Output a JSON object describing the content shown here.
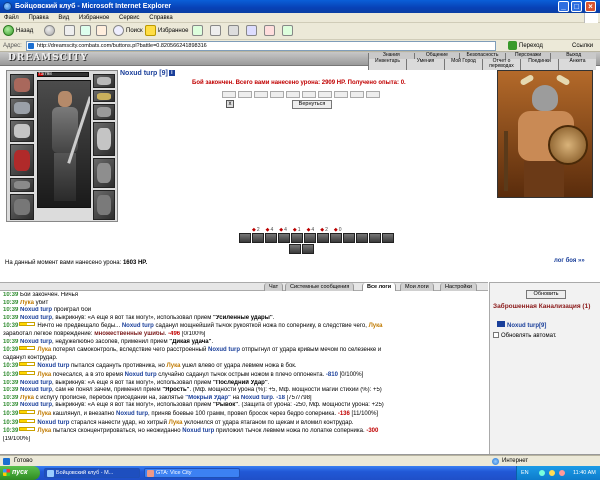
{
  "window": {
    "title": "Бойцовский клуб - Microsoft Internet Explorer",
    "min": "_",
    "max": "□",
    "close": "×"
  },
  "menu": [
    "Файл",
    "Правка",
    "Вид",
    "Избранное",
    "Сервис",
    "Справка"
  ],
  "toolbar": {
    "back": "Назад",
    "search": "Поиск",
    "favorites": "Избранное"
  },
  "address": {
    "label": "Адрес:",
    "url": "http://dreamscity.combats.com/buttons.pl?battle=0.820566241898316",
    "go": "Переход",
    "links": "Ссылки"
  },
  "site": {
    "logo": "DREAMSCITY",
    "nav_top": [
      "Знания",
      "Общение",
      "Безопасность",
      "Персонажи",
      "Выход"
    ],
    "nav_bottom": [
      "Инвентарь",
      "Умения",
      "Мой Город",
      "Отчет о переводах",
      "Поединки",
      "Анкета"
    ]
  },
  "player": {
    "name": "Noxud turp [9]",
    "hp": "73/798",
    "hp_fraction": 0.09
  },
  "battle": {
    "summary": "Бой закончен. Всего вами нанесено урона: 2909 HP. Получено опыта: 0.",
    "close": "x",
    "return_button": "Вернуться",
    "stats": [
      "2",
      "4",
      "4",
      "1",
      "4",
      "2",
      "0"
    ],
    "damage_label": "На данный момент вами нанесено урона:",
    "damage_value": "1603 HP.",
    "log_link": "лог боя »»"
  },
  "chat": {
    "tabs": [
      "Чат",
      "Системные сообщения",
      "Все логи",
      "Мои логи",
      "Настройки"
    ],
    "lines": [
      [
        {
          "c": "t",
          "v": "10:39"
        },
        {
          "c": "",
          "v": " Бой закончен. Ничья"
        }
      ],
      [
        {
          "c": "t",
          "v": "10:39"
        },
        {
          "c": "",
          "v": " "
        },
        {
          "c": "e",
          "v": "Лука"
        },
        {
          "c": "",
          "v": " убит"
        }
      ],
      [
        {
          "c": "t",
          "v": "10:39"
        },
        {
          "c": "",
          "v": " "
        },
        {
          "c": "p",
          "v": "Noxud turp"
        },
        {
          "c": "",
          "v": " проиграл бой"
        }
      ],
      [
        {
          "c": "t",
          "v": "10:39"
        },
        {
          "c": "",
          "v": " "
        },
        {
          "c": "p",
          "v": "Noxud turp"
        },
        {
          "c": "",
          "v": ", выкрикнув: «А ещё я вот так могу!», использовал прием "
        },
        {
          "c": "q",
          "v": "\"Усиленные удары\""
        },
        {
          "c": "",
          "v": "."
        }
      ],
      [
        {
          "c": "t",
          "v": "10:39"
        },
        {
          "c": "m",
          "v": ""
        },
        {
          "c": "",
          "v": "Ничто не предвещало беды... "
        },
        {
          "c": "p",
          "v": "Noxud turp"
        },
        {
          "c": "",
          "v": " саданул мощнейший тычок рукояткой ножа по сопернику, в следствие чего, "
        },
        {
          "c": "e",
          "v": "Лука"
        }
      ],
      [
        {
          "c": "",
          "v": "заработал легкое повреждение: "
        },
        {
          "c": "w",
          "v": "множественные ушибы"
        },
        {
          "c": "",
          "v": ". "
        },
        {
          "c": "n",
          "v": "-496"
        },
        {
          "c": "",
          "v": " [0/100%]"
        }
      ],
      [
        {
          "c": "t",
          "v": "10:39"
        },
        {
          "c": "",
          "v": " "
        },
        {
          "c": "p",
          "v": "Noxud turp"
        },
        {
          "c": "",
          "v": ", недужелюбно засопев, применил прием "
        },
        {
          "c": "q",
          "v": "\"Дикая удача\""
        },
        {
          "c": "",
          "v": "."
        }
      ],
      [
        {
          "c": "t",
          "v": "10:39"
        },
        {
          "c": "m",
          "v": ""
        },
        {
          "c": "e",
          "v": "Лука"
        },
        {
          "c": "",
          "v": " потерял самоконтроль, вследствие чего расстроенный "
        },
        {
          "c": "p",
          "v": "Noxud turp"
        },
        {
          "c": "",
          "v": " отпрыгнул от удара кривым мечом по селезенке и"
        }
      ],
      [
        {
          "c": "",
          "v": "саданул контрудар."
        }
      ],
      [
        {
          "c": "t",
          "v": "10:39"
        },
        {
          "c": "m",
          "v": ""
        },
        {
          "c": "p",
          "v": "Noxud turp"
        },
        {
          "c": "",
          "v": " пытался садануть противника, но "
        },
        {
          "c": "e",
          "v": "Лука"
        },
        {
          "c": "",
          "v": " ушел влево от удара левмем ножа в бок."
        }
      ],
      [
        {
          "c": "t",
          "v": "10:39"
        },
        {
          "c": "m",
          "v": ""
        },
        {
          "c": "e",
          "v": "Лука"
        },
        {
          "c": "",
          "v": " почесался, а в это время "
        },
        {
          "c": "p",
          "v": "Noxud turp"
        },
        {
          "c": "",
          "v": " случайно саданул тычок острым ножом в плечо оппонента. "
        },
        {
          "c": "b",
          "v": "-810"
        },
        {
          "c": "",
          "v": " [0/100%]"
        }
      ],
      [
        {
          "c": "t",
          "v": "10:39"
        },
        {
          "c": "",
          "v": " "
        },
        {
          "c": "p",
          "v": "Noxud turp"
        },
        {
          "c": "",
          "v": ", выкрикнув: «А ещё я вот так могу!», использовал прием "
        },
        {
          "c": "q",
          "v": "\"Последний Удар\""
        },
        {
          "c": "",
          "v": "."
        }
      ],
      [
        {
          "c": "t",
          "v": "10:39"
        },
        {
          "c": "",
          "v": " "
        },
        {
          "c": "p",
          "v": "Noxud turp"
        },
        {
          "c": "",
          "v": ", сам не понял зачем, применил прием "
        },
        {
          "c": "q",
          "v": "\"Ярость\""
        },
        {
          "c": "",
          "v": ". (Мф. мощности урона (%): +5, Мф. мощности магии стихий (%): +5)"
        }
      ],
      [
        {
          "c": "t",
          "v": "10:39"
        },
        {
          "c": "",
          "v": " "
        },
        {
          "c": "e",
          "v": "Лука"
        },
        {
          "c": "",
          "v": " с испугу прописне, перебон приседаний на, заклятье "
        },
        {
          "c": "b",
          "v": "\"Мокрый Удар\""
        },
        {
          "c": "",
          "v": " на "
        },
        {
          "c": "p",
          "v": "Noxud turp"
        },
        {
          "c": "",
          "v": ". "
        },
        {
          "c": "b",
          "v": "-18"
        },
        {
          "c": "",
          "v": " [757/798]"
        }
      ],
      [
        {
          "c": "t",
          "v": "10:39"
        },
        {
          "c": "",
          "v": " "
        },
        {
          "c": "p",
          "v": "Noxud turp"
        },
        {
          "c": "",
          "v": ", выкрикнув: «А ещё я вот так могу!», использовал прием "
        },
        {
          "c": "q",
          "v": "\"Рывок\""
        },
        {
          "c": "",
          "v": ". (Защита от урона: -250, Мф. мощности урона: +25)"
        }
      ],
      [
        {
          "c": "t",
          "v": "10:39"
        },
        {
          "c": "m",
          "v": ""
        },
        {
          "c": "e",
          "v": "Лука"
        },
        {
          "c": "",
          "v": " кашлянул, и внезапно "
        },
        {
          "c": "p",
          "v": "Noxud turp"
        },
        {
          "c": "",
          "v": ", приняв боевые 100 грамм, провел бросок через бедро соперника. "
        },
        {
          "c": "n",
          "v": "-136"
        },
        {
          "c": "",
          "v": " [11/100%]"
        }
      ],
      [
        {
          "c": "t",
          "v": "10:39"
        },
        {
          "c": "m",
          "v": ""
        },
        {
          "c": "p",
          "v": "Noxud turp"
        },
        {
          "c": "",
          "v": " старался нанести удар, но хитрый "
        },
        {
          "c": "e",
          "v": "Лука"
        },
        {
          "c": "",
          "v": " уклонился от удара ятаганом по щекам и вломил контрудар."
        }
      ],
      [
        {
          "c": "t",
          "v": "10:39"
        },
        {
          "c": "m",
          "v": ""
        },
        {
          "c": "e",
          "v": "Лука"
        },
        {
          "c": "",
          "v": " пытался сконцентрироваться, но неожиданно "
        },
        {
          "c": "p",
          "v": "Noxud turp"
        },
        {
          "c": "",
          "v": " приложил тычок левмем ножа по лопатке соперника. "
        },
        {
          "c": "n",
          "v": "-300"
        }
      ],
      [
        {
          "c": "",
          "v": "[19/100%]"
        }
      ]
    ]
  },
  "side": {
    "refresh": "Обновить",
    "location": "Заброшенная Канализация (1)",
    "online_user": "Noxud turp[9]",
    "auto_refresh": "Обновлять автомат."
  },
  "status": {
    "ready": "Готово",
    "zone": "Интернет"
  },
  "taskbar": {
    "start": "пуск",
    "tasks": [
      "Бойцовский клуб - M...",
      "GTA: Vice City"
    ],
    "lang": "EN",
    "clock": "11:40 AM"
  }
}
